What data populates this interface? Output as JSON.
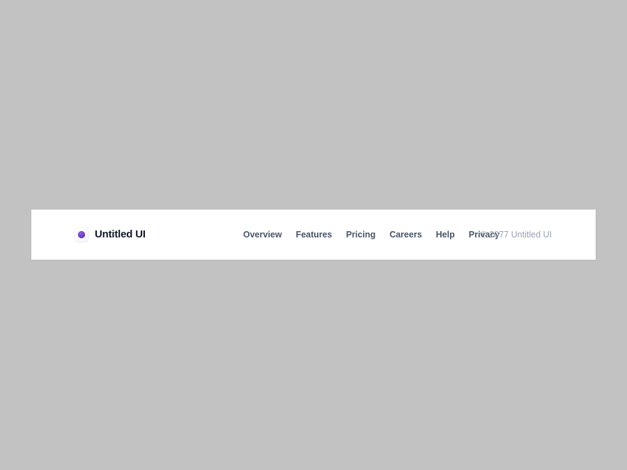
{
  "page": {
    "background_color": "#c2c2c2"
  },
  "footer": {
    "background_color": "#ffffff",
    "brand": {
      "logo_icon": "untitled-ui-logo-icon",
      "logo_color_outer": "#7f56d9",
      "logo_color_inner": "#6941c6",
      "name": "Untitled UI"
    },
    "nav": {
      "items": [
        {
          "label": "Overview"
        },
        {
          "label": "Features"
        },
        {
          "label": "Pricing"
        },
        {
          "label": "Careers"
        },
        {
          "label": "Help"
        },
        {
          "label": "Privacy"
        }
      ],
      "link_color": "#475467"
    },
    "copyright": {
      "text": "© 2077 Untitled UI",
      "color": "#98a2b3"
    }
  }
}
